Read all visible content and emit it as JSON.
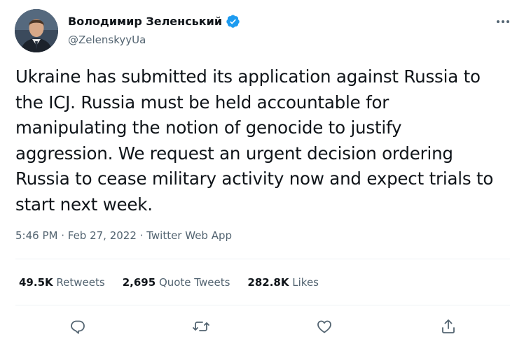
{
  "author": {
    "display_name": "Володимир Зеленський",
    "handle": "@ZelenskyyUa",
    "verified": true
  },
  "tweet": {
    "text": "Ukraine has submitted its application against Russia to\nthe ICJ. Russia must be held accountable for\nmanipulating the notion of genocide to justify\naggression. We request an urgent decision ordering\nRussia to cease military activity now and expect trials to\nstart next week.",
    "time": "5:46 PM",
    "date": "Feb 27, 2022",
    "source": "Twitter Web App",
    "separator": " · "
  },
  "stats": {
    "retweets": {
      "count": "49.5K",
      "label": "Retweets"
    },
    "quote_tweets": {
      "count": "2,695",
      "label": "Quote Tweets"
    },
    "likes": {
      "count": "282.8K",
      "label": "Likes"
    }
  },
  "icons": {
    "verified": "verified-badge-icon",
    "more": "more-options-icon",
    "reply": "reply-icon",
    "retweet": "retweet-icon",
    "like": "heart-icon",
    "share": "share-icon"
  },
  "colors": {
    "verified_blue": "#1d9bf0",
    "text_primary": "#0f1419",
    "text_secondary": "#536471",
    "divider": "#eff3f4"
  }
}
